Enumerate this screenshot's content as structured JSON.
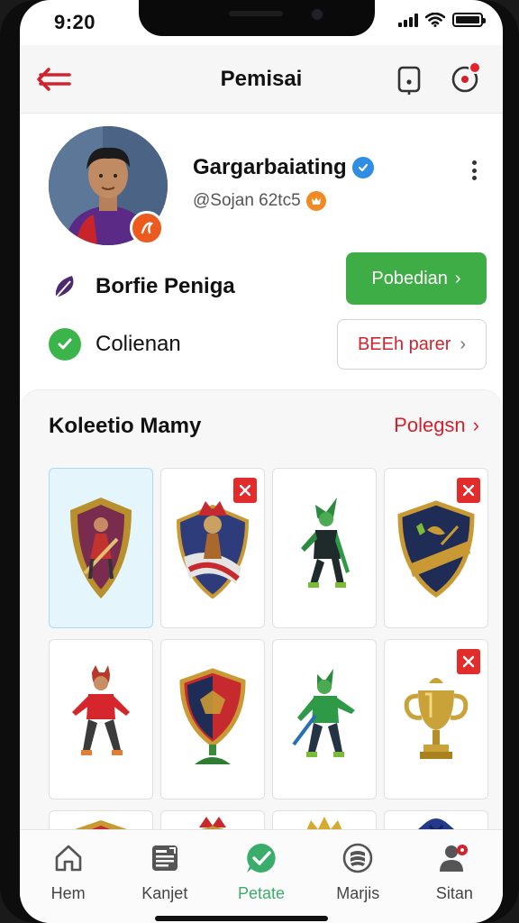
{
  "status_bar": {
    "time": "9:20"
  },
  "header": {
    "title": "Pemisai"
  },
  "profile": {
    "name": "Gargarbaiating",
    "handle": "@Sojan 62tc5",
    "rows": [
      {
        "label": "Borfie Peniga",
        "icon": "feather-icon"
      },
      {
        "label": "Colienan",
        "icon": "check-circle-icon"
      }
    ],
    "primary_button": "Pobedian",
    "secondary_button": "BEEh parer"
  },
  "collection": {
    "title": "Koleetio Mamy",
    "link": "Polegsn",
    "items": [
      {
        "name": "shield-player",
        "selected": true,
        "removable": false
      },
      {
        "name": "shield-warrior",
        "selected": false,
        "removable": true
      },
      {
        "name": "green-figure",
        "selected": false,
        "removable": false
      },
      {
        "name": "blue-shield",
        "selected": false,
        "removable": true
      },
      {
        "name": "red-figure",
        "selected": false,
        "removable": false
      },
      {
        "name": "trophy-shield",
        "selected": false,
        "removable": false
      },
      {
        "name": "green-figure-2",
        "selected": false,
        "removable": false
      },
      {
        "name": "gold-trophy",
        "selected": false,
        "removable": true
      }
    ]
  },
  "tabs": [
    {
      "label": "Hem",
      "icon": "home-icon",
      "active": false
    },
    {
      "label": "Kanjet",
      "icon": "newspaper-icon",
      "active": false
    },
    {
      "label": "Petate",
      "icon": "check-bubble-icon",
      "active": true
    },
    {
      "label": "Marjis",
      "icon": "cards-icon",
      "active": false
    },
    {
      "label": "Sitan",
      "icon": "profile-settings-icon",
      "active": false
    }
  ],
  "colors": {
    "accent_red": "#d4222c",
    "accent_green": "#3fad46",
    "tab_active": "#3aad6b",
    "verified_blue": "#2f8de4"
  }
}
